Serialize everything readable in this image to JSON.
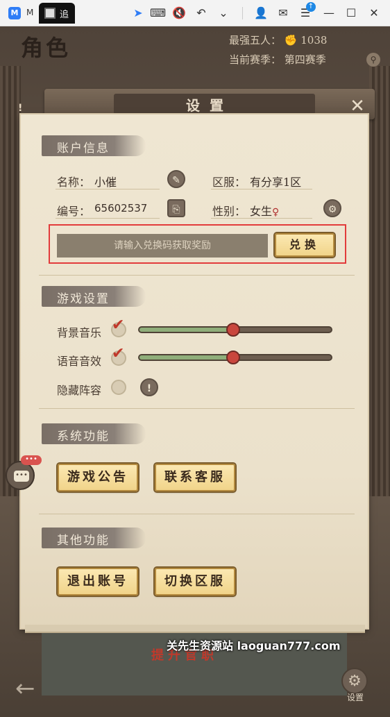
{
  "emulator": {
    "app_letter": "M",
    "tab_char": "追",
    "icons": [
      "cursor-icon",
      "keyboard-icon",
      "mute-icon",
      "undo-icon",
      "chevron-down-icon",
      "user-icon",
      "mail-icon",
      "menu-icon",
      "minimize-icon",
      "maximize-icon",
      "close-icon"
    ]
  },
  "game": {
    "role_title": "角色",
    "strongest_five_label": "最强五人：",
    "strongest_five_value": "1038",
    "season_label": "当前赛季：",
    "season_value": "第四赛季",
    "left_exclaim": "!"
  },
  "modal": {
    "title": "设置",
    "close_glyph": "✕"
  },
  "account": {
    "section_title": "账户信息",
    "name_label": "名称：",
    "name_value": "小催",
    "server_label": "区服：",
    "server_value": "有分享1区",
    "id_label": "编号：",
    "id_value": "65602537",
    "gender_label": "性别：",
    "gender_value": "女生",
    "gender_mark": "♀",
    "redeem_placeholder": "请输入兑换码获取奖励",
    "redeem_button": "兑换"
  },
  "game_settings": {
    "section_title": "游戏设置",
    "bgm_label": "背景音乐",
    "bgm_checked": true,
    "bgm_level": 0.49,
    "voice_label": "语音音效",
    "voice_checked": true,
    "voice_level": 0.49,
    "hide_lineup_label": "隐藏阵容",
    "hide_lineup_checked": false,
    "info_glyph": "!"
  },
  "system": {
    "section_title": "系统功能",
    "announce_button": "游戏公告",
    "support_button": "联系客服"
  },
  "other": {
    "section_title": "其他功能",
    "logout_button": "退出账号",
    "switch_server_button": "切换区服"
  },
  "bottom": {
    "banner_text": "提升官职",
    "watermark": "关先生资源站 laoguan777.com",
    "settings_label": "设置",
    "chat_badge": "•••"
  }
}
